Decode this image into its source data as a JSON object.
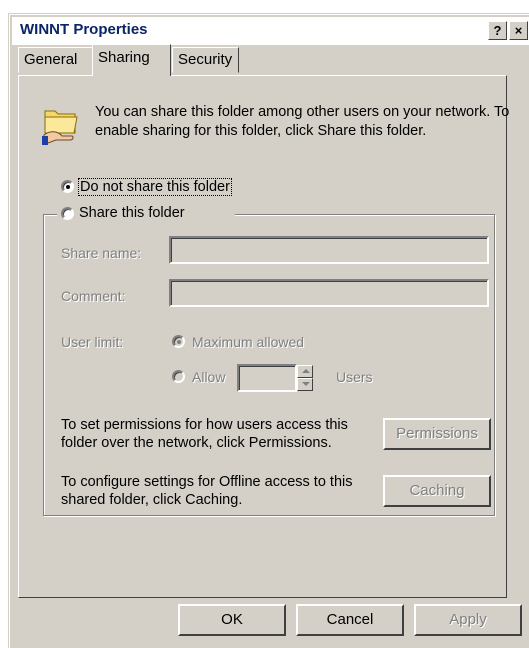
{
  "window": {
    "title": "WINNT Properties",
    "help_glyph": "?",
    "close_glyph": "×"
  },
  "tabs": [
    {
      "label": "General",
      "active": false
    },
    {
      "label": "Sharing",
      "active": true
    },
    {
      "label": "Security",
      "active": false
    }
  ],
  "intro_text": "You can share this folder among other users on your network.  To enable sharing for this folder, click Share this folder.",
  "options": {
    "do_not_share": {
      "label": "Do not share this folder",
      "checked": true
    },
    "share": {
      "label": "Share this folder",
      "checked": false
    }
  },
  "fields": {
    "share_name_label": "Share name:",
    "share_name_value": "",
    "comment_label": "Comment:",
    "comment_value": "",
    "user_limit_label": "User limit:",
    "maximum_allowed_label": "Maximum allowed",
    "allow_label": "Allow",
    "allow_value": "",
    "users_label": "Users"
  },
  "permissions": {
    "text": "To set permissions for how users access this folder over the network, click Permissions.",
    "button": "Permissions"
  },
  "caching": {
    "text": "To configure settings for Offline access to this shared folder, click Caching.",
    "button": "Caching"
  },
  "footer": {
    "ok": "OK",
    "cancel": "Cancel",
    "apply": "Apply"
  },
  "colors": {
    "face": "#d4d0c8",
    "title_text": "#0a246a",
    "disabled_text": "#808080"
  }
}
